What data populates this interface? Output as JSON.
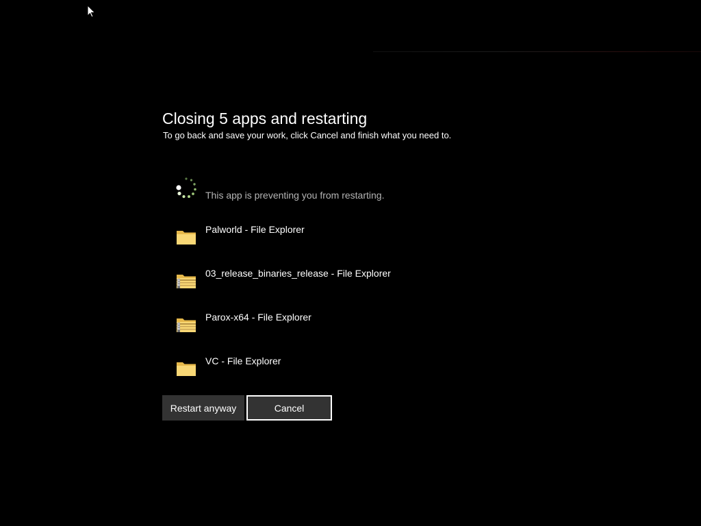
{
  "dialog": {
    "title": "Closing 5 apps and restarting",
    "subtitle": "To go back and save your work, click Cancel and finish what you need to."
  },
  "apps": [
    {
      "label": "This app is preventing you from restarting.",
      "icon": "loading-spinner-icon"
    },
    {
      "label": "Palworld - File Explorer",
      "icon": "folder-icon"
    },
    {
      "label": "03_release_binaries_release - File Explorer",
      "icon": "zipped-folder-icon"
    },
    {
      "label": "Parox-x64 - File Explorer",
      "icon": "zipped-folder-icon"
    },
    {
      "label": "VC - File Explorer",
      "icon": "folder-icon"
    }
  ],
  "buttons": {
    "restart_anyway": "Restart anyway",
    "cancel": "Cancel"
  },
  "colors": {
    "background": "#000000",
    "button_bg": "#333333",
    "button_focus_border": "#ffffff",
    "folder": "#f8d775",
    "spinner": "#8fbf6a"
  }
}
